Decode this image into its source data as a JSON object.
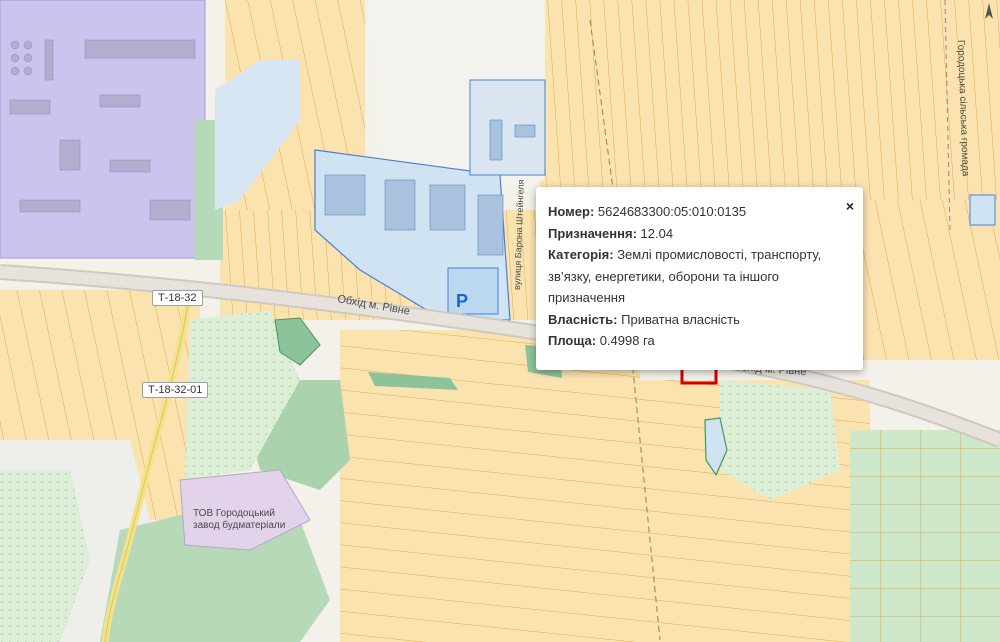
{
  "map": {
    "road_labels": {
      "bypass_west": "Обхід м. Рівне",
      "bypass_east": "Обхід м. Рівне",
      "street_vertical": "вулиця Барона Штейнгеля",
      "community": "Городоцька сільська громада"
    },
    "road_badges": {
      "t1": "Т-18-32",
      "t2": "Т-18-32-01"
    },
    "parking_label": "P",
    "poi": {
      "line1": "ТОВ Городоцький",
      "line2": "завод будматеріали"
    }
  },
  "popup": {
    "number_label": "Номер:",
    "number_value": "5624683300:05:010:0135",
    "purpose_label": "Призначення:",
    "purpose_value": "12.04",
    "category_label": "Категорія:",
    "category_value": "Землі промисловості, транспорту, зв’язку, енергетики, оборони та іншого призначення",
    "ownership_label": "Власність:",
    "ownership_value": "Приватна власність",
    "area_label": "Площа:",
    "area_value": "0.4998 га",
    "close": "×"
  },
  "colors": {
    "parcel_fill": "#fbe3b0",
    "parcel_stroke": "#e2a84b",
    "industrial": "#cbc4ee",
    "water_blue": "#cfe3f2",
    "forest_green": "#b6d9b8",
    "highlight": "#d40000"
  }
}
